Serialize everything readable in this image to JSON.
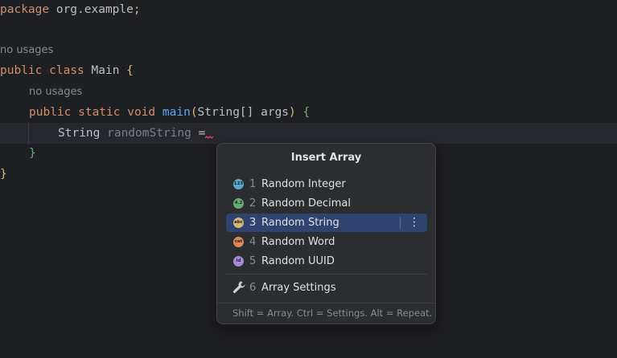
{
  "editor": {
    "package_kw": "package",
    "package_name": " org.example",
    "package_semi": ";",
    "usage_hint_class": "no usages",
    "class_public": "public",
    "class_kw": " class",
    "class_name": " Main",
    "class_open": " {",
    "usage_hint_method": "no usages",
    "method_public": "public",
    "method_static": " static",
    "method_void": " void",
    "method_name": " main",
    "method_paren_open": "(",
    "method_param_type": "String[]",
    "method_param_name": " args",
    "method_paren_close": ")",
    "method_open": " {",
    "stmt_type": "String",
    "stmt_var": " randomString",
    "stmt_eq": " =",
    "method_close": "}",
    "class_close": "}"
  },
  "popup": {
    "title": "Insert Array",
    "items": [
      {
        "num": "1",
        "label": "Random Integer",
        "badge": "123",
        "badge_color": "#56a8c9",
        "icon": "integer-icon"
      },
      {
        "num": "2",
        "label": "Random Decimal",
        "badge": "4.2",
        "badge_color": "#6aab73",
        "icon": "decimal-icon"
      },
      {
        "num": "3",
        "label": "Random String",
        "badge": "abc",
        "badge_color": "#d5b778",
        "icon": "string-icon"
      },
      {
        "num": "4",
        "label": "Random Word",
        "badge": "cat",
        "badge_color": "#e08855",
        "icon": "word-icon"
      },
      {
        "num": "5",
        "label": "Random UUID",
        "badge": "id",
        "badge_color": "#a48ad5",
        "icon": "uuid-icon"
      }
    ],
    "selected_index": 2,
    "more_glyph": "⋮",
    "settings": {
      "num": "6",
      "label": "Array Settings",
      "icon": "wrench-icon"
    },
    "footer": "Shift = Array. Ctrl = Settings. Alt = Repeat."
  },
  "colors": {
    "background": "#1e1f22",
    "selection": "#2e436e",
    "keyword": "#cf8e6d",
    "function": "#56a8f5"
  }
}
